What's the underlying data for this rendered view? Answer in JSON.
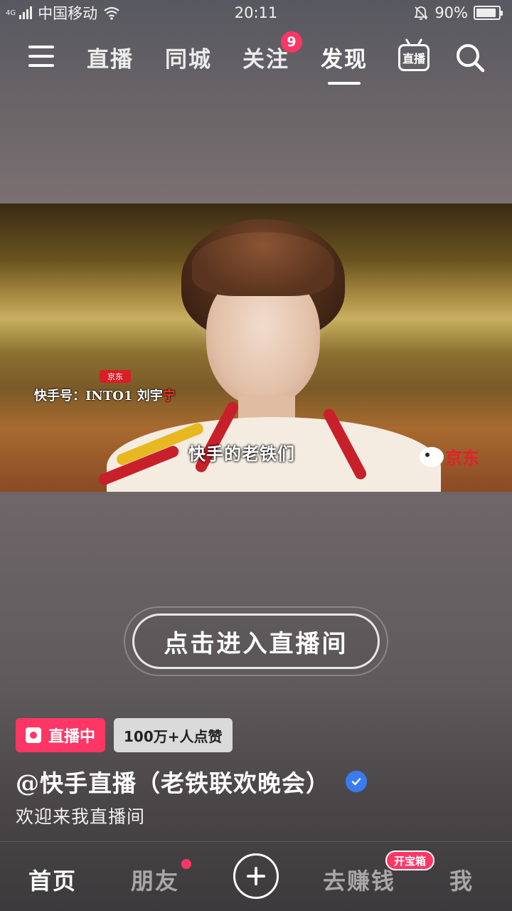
{
  "status_bar": {
    "network_type": "4G",
    "carrier": "中国移动",
    "time": "20:11",
    "battery": "90%",
    "battery_level": 0.9
  },
  "top_nav": {
    "tabs": [
      {
        "label": "直播",
        "active": false
      },
      {
        "label": "同城",
        "active": false
      },
      {
        "label": "关注",
        "active": false,
        "badge": "9"
      },
      {
        "label": "发现",
        "active": true
      }
    ],
    "live_tv_label": "直播"
  },
  "video": {
    "caption": "快手的老铁们",
    "handle_prefix": "快手号：INTO1 刘宇",
    "handle_suffix": "宁",
    "tag": "京东",
    "watermark": "京东"
  },
  "enter_live_label": "点击进入直播间",
  "info": {
    "live_tag": "直播中",
    "likes_tag": "100万+人点赞",
    "author": "@快手直播（老铁联欢晚会）",
    "description": "欢迎来我直播间"
  },
  "bottom_nav": {
    "items": [
      {
        "label": "首页",
        "active": true
      },
      {
        "label": "朋友",
        "active": false,
        "dot": true
      },
      {
        "label": "去赚钱",
        "active": false,
        "badge": "开宝箱"
      },
      {
        "label": "我",
        "active": false
      }
    ]
  },
  "colors": {
    "accent": "#fe3666",
    "verified": "#3a7cf0",
    "jd_red": "#e4202a"
  }
}
